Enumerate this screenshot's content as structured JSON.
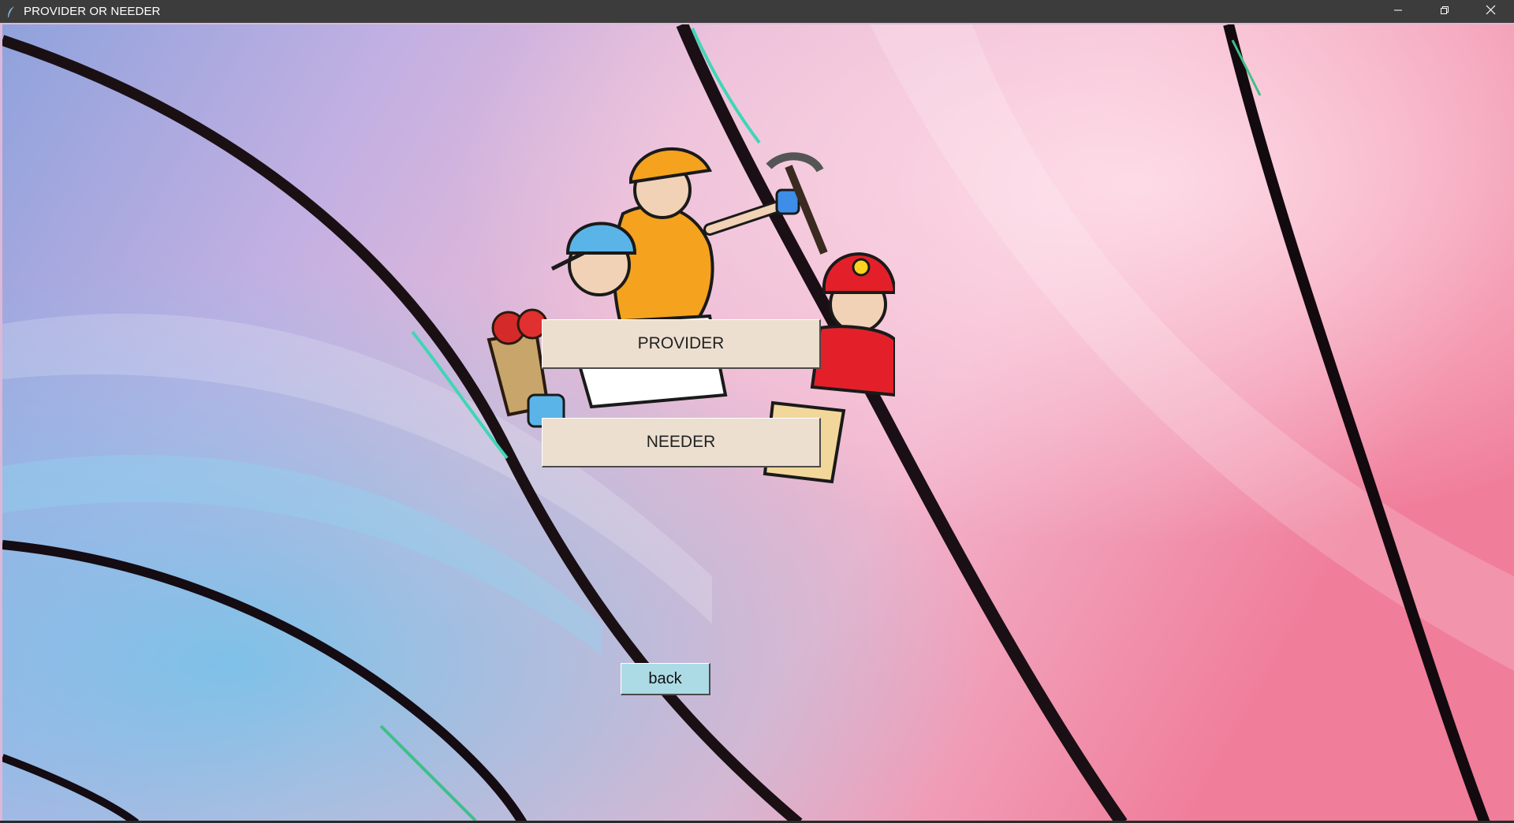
{
  "window": {
    "title": "PROVIDER OR NEEDER",
    "app_icon": "feather-icon",
    "controls": {
      "minimize_icon": "minimize-icon",
      "maximize_icon": "restore-icon",
      "close_icon": "close-icon"
    }
  },
  "main": {
    "background": "abstract-pink-blue-waves-wallpaper",
    "illustration": "workers-cartoon-illustration",
    "provider_label": "PROVIDER",
    "needer_label": "NEEDER",
    "back_label": "back"
  },
  "colors": {
    "titlebar": "#3c3c3c",
    "role_button": "#ecdfcf",
    "back_button": "#acdbe6"
  }
}
